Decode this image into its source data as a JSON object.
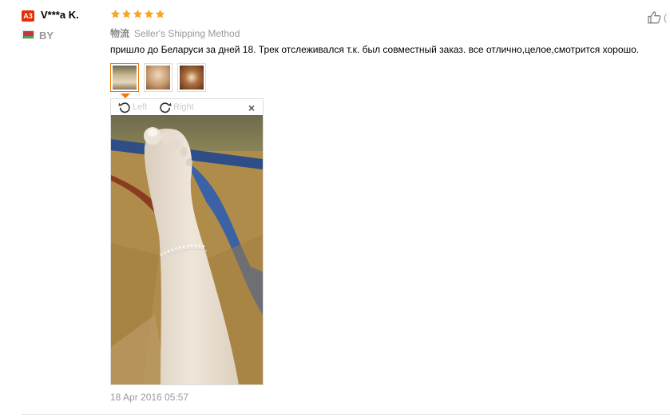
{
  "review": {
    "avatar_badge": "A3",
    "username": "V***a K.",
    "country_code": "BY",
    "rating": 5,
    "logistics_label": "物流",
    "shipping_method": "Seller's Shipping Method",
    "text": "пришло до Беларуси за дней 18. Трек отслеживался т.к. был совместный заказ. все отлично,целое,смотрится хорошо.",
    "timestamp": "18 Apr 2016 05:57",
    "helpful_text": "(",
    "photo_count": 3,
    "active_photo_index": 0
  },
  "viewer": {
    "rotate_left_label": "Left",
    "rotate_right_label": "Right",
    "close_symbol": "×"
  },
  "icons": {
    "star": "star-icon",
    "thumbs_up": "thumbs-up-icon",
    "rotate_left": "rotate-left-icon",
    "rotate_right": "rotate-right-icon",
    "close": "close-icon",
    "flag": "belarus-flag-icon"
  },
  "colors": {
    "badge": "#e62e04",
    "star": "#f6a623",
    "active_thumb": "#f07808",
    "muted_text": "#999999"
  }
}
